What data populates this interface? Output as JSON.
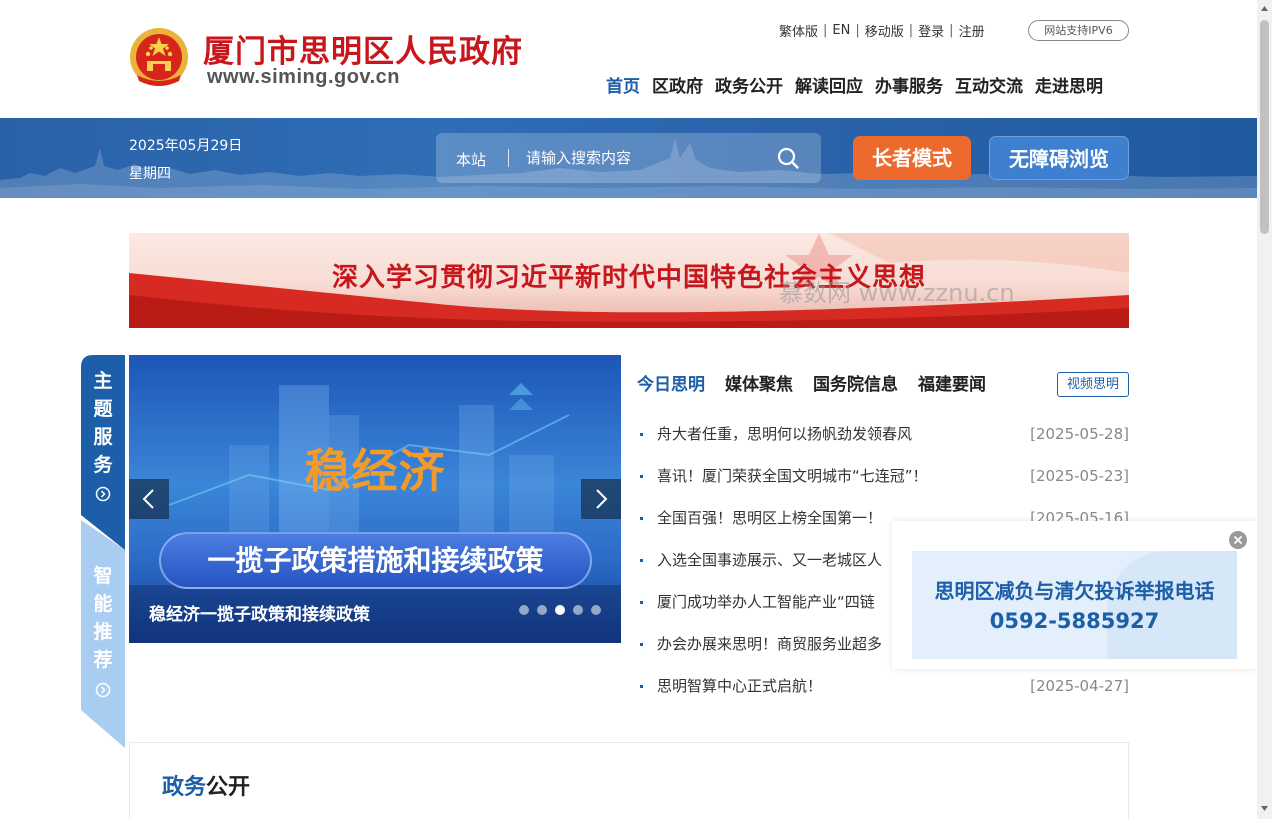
{
  "header": {
    "site_name": "厦门市思明区人民政府",
    "site_url": "www.siming.gov.cn",
    "top_links": [
      "繁体版",
      "EN",
      "移动版",
      "登录",
      "注册"
    ],
    "ipv6_label": "网站支持IPV6",
    "nav": [
      "首页",
      "区政府",
      "政务公开",
      "解读回应",
      "办事服务",
      "互动交流",
      "走进思明"
    ],
    "nav_active": "首页"
  },
  "band": {
    "date": "2025年05月29日",
    "weekday": "星期四",
    "search": {
      "scope": "本站",
      "placeholder": "请输入搜索内容"
    },
    "elder_mode": "长者模式",
    "accessible": "无障碍浏览"
  },
  "theme_banner": {
    "text": "深入学习贯彻习近平新时代中国特色社会主义思想",
    "watermark": "慕数网 www.zznu.cn"
  },
  "side_tabs": [
    {
      "label": [
        "主",
        "题",
        "服",
        "务"
      ]
    },
    {
      "label": [
        "智",
        "能",
        "推",
        "荐"
      ]
    }
  ],
  "carousel": {
    "big_title": "稳经济",
    "pill_text": "一揽子政策措施和接续政策",
    "caption": "稳经济一揽子政策和接续政策",
    "slide_count": 5,
    "active_slide": 3
  },
  "news": {
    "tabs": [
      "今日思明",
      "媒体聚焦",
      "国务院信息",
      "福建要闻"
    ],
    "active_tab": "今日思明",
    "video_button": "视频思明",
    "items": [
      {
        "title": "舟大者任重，思明何以扬帆劲发领春风",
        "date": "[2025-05-28]"
      },
      {
        "title": "喜讯！厦门荣获全国文明城市“七连冠”！",
        "date": "[2025-05-23]"
      },
      {
        "title": "全国百强！思明区上榜全国第一！",
        "date": "[2025-05-16]"
      },
      {
        "title": "入选全国事迹展示、又一老城区人",
        "date": ""
      },
      {
        "title": "厦门成功举办人工智能产业“四链",
        "date": ""
      },
      {
        "title": "办会办展来思明！商贸服务业超多",
        "date": ""
      },
      {
        "title": "思明智算中心正式启航！",
        "date": "[2025-04-27]"
      }
    ]
  },
  "popup": {
    "line1": "思明区减负与清欠投诉举报电话",
    "line2": "0592-5885927"
  },
  "section": {
    "title_a": "政务",
    "title_b": "公开"
  },
  "colors": {
    "brand_red": "#c8161d",
    "brand_blue": "#1d5ea8",
    "band_blue": "#2a62a8",
    "elder_orange": "#ec6a2d",
    "accessible_blue": "#3f7fd0"
  }
}
